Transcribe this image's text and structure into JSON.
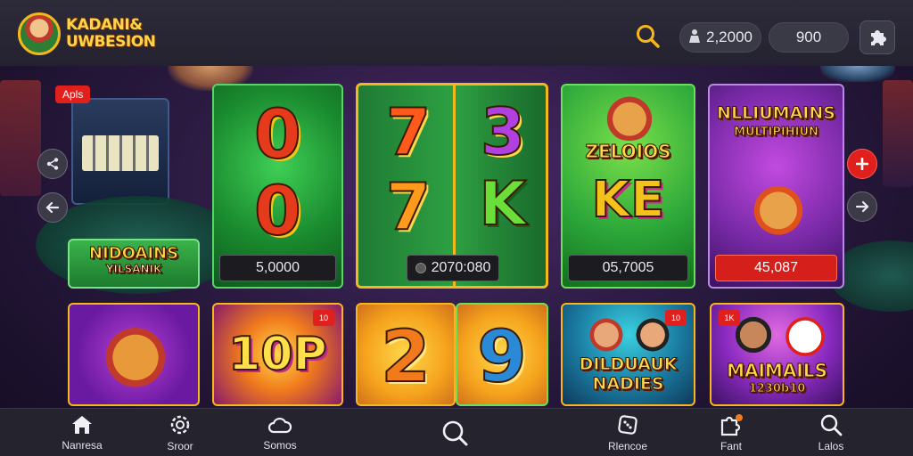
{
  "header": {
    "logo_line1": "KADANI&",
    "logo_line2": "UWBESION",
    "balance": "2,2000",
    "credit": "900"
  },
  "promo_tag": "Apls",
  "games": [
    {
      "id": "g1",
      "title_line1": "NIDOAINS",
      "title_line2": "YILSANIK"
    },
    {
      "id": "g2",
      "symbols": [
        "0",
        "0"
      ],
      "value": "5,0000"
    },
    {
      "id": "g3",
      "symbols": [
        "7",
        "3",
        "7",
        "K"
      ],
      "value": "2070:080"
    },
    {
      "id": "g4",
      "title": "ZELOIOS",
      "symbol": "KE",
      "value": "05,7005"
    },
    {
      "id": "g5",
      "title_line1": "NLLIUMAINS",
      "title_line2": "MULTIPIHIUN",
      "value": "45,087"
    },
    {
      "id": "g6",
      "badge": ""
    },
    {
      "id": "g7",
      "title": "10P",
      "badge": "10"
    },
    {
      "id": "g8",
      "symbol": "2"
    },
    {
      "id": "g9",
      "symbol": "9"
    },
    {
      "id": "g10",
      "title_line1": "DILDUAUK",
      "title_line2": "NADIES",
      "badge": "10"
    },
    {
      "id": "g11",
      "title_line1": "MAIMAILS",
      "title_line2": "1230b10",
      "badge": "1K"
    }
  ],
  "nav": [
    {
      "label": "Nanresa",
      "icon": "home-icon"
    },
    {
      "label": "Sroor",
      "icon": "gear-icon"
    },
    {
      "label": "Somos",
      "icon": "cloud-icon"
    },
    {
      "label": "",
      "icon": "search-icon"
    },
    {
      "label": "Rlencoe",
      "icon": "dice-icon"
    },
    {
      "label": "Fant",
      "icon": "puzzle-icon"
    },
    {
      "label": "Lalos",
      "icon": "search-icon"
    }
  ],
  "colors": {
    "accent_gold": "#f5b81c",
    "accent_red": "#e0201c",
    "card_green": "#1f8a3a"
  }
}
